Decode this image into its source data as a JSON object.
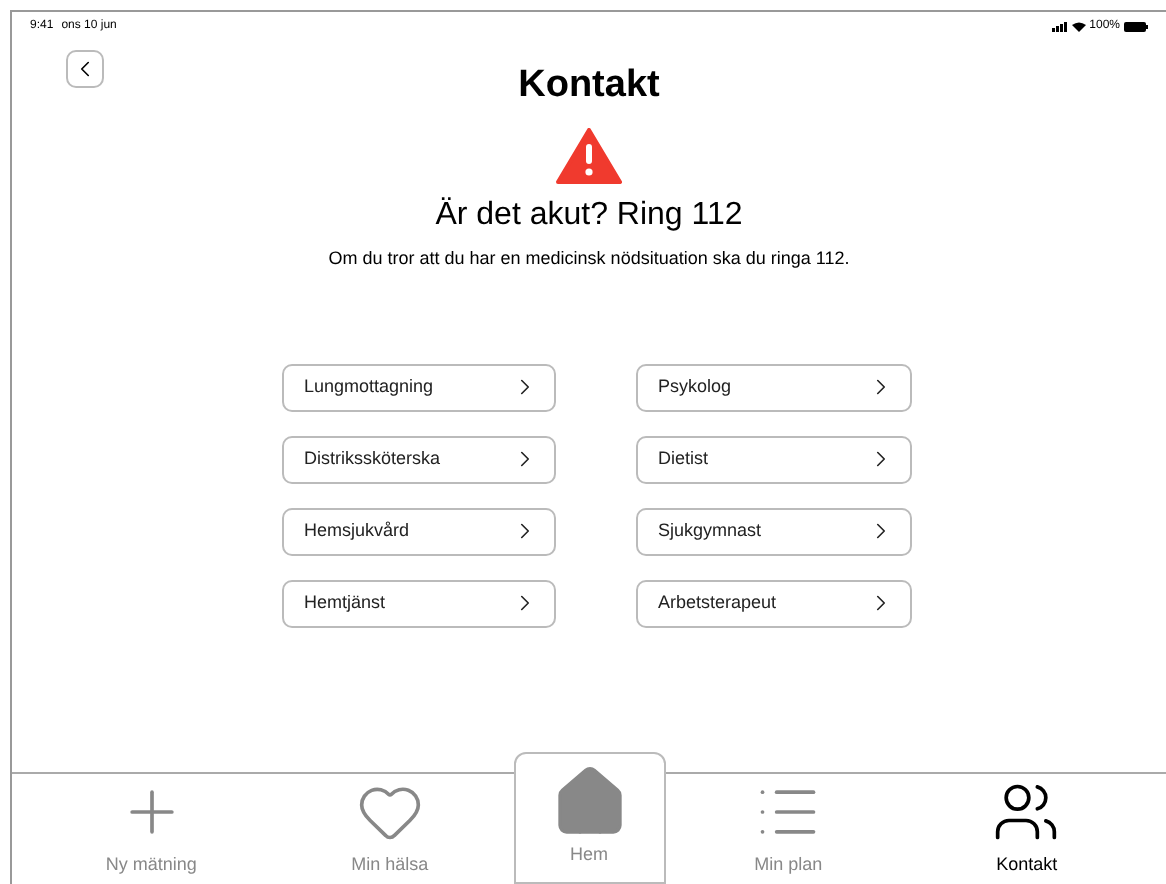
{
  "status_bar": {
    "time": "9:41",
    "date": "ons 10 jun",
    "battery": "100%"
  },
  "header": {
    "title": "Kontakt"
  },
  "alert": {
    "heading": "Är det akut? Ring 112",
    "text": "Om du tror att du har en medicinsk nödsituation ska du ringa 112."
  },
  "contacts": [
    {
      "label": "Lungmottagning"
    },
    {
      "label": "Psykolog"
    },
    {
      "label": "Distrikssköterska"
    },
    {
      "label": "Dietist"
    },
    {
      "label": "Hemsjukvård"
    },
    {
      "label": "Sjukgymnast"
    },
    {
      "label": "Hemtjänst"
    },
    {
      "label": "Arbetsterapeut"
    }
  ],
  "tabs": [
    {
      "label": "Ny mätning",
      "selected": false,
      "kind": "plain"
    },
    {
      "label": "Min hälsa",
      "selected": false,
      "kind": "plain"
    },
    {
      "label": "Hem",
      "selected": false,
      "kind": "raised"
    },
    {
      "label": "Min plan",
      "selected": false,
      "kind": "plain"
    },
    {
      "label": "Kontakt",
      "selected": true,
      "kind": "plain"
    }
  ]
}
